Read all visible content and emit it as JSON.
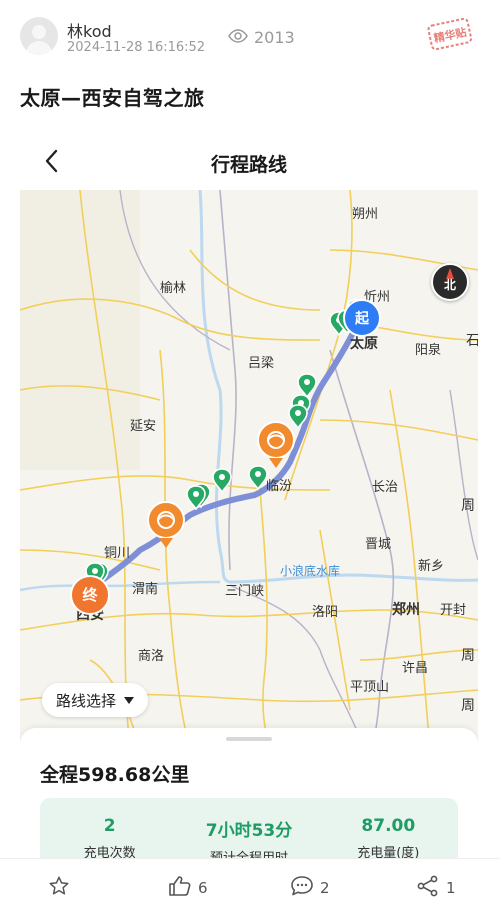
{
  "post": {
    "author": "林kod",
    "time": "2024-11-28 16:16:52",
    "views": "2013",
    "badge": "精华贴",
    "title": "太原—西安自驾之旅"
  },
  "route_screen": {
    "title": "行程路线",
    "route_select_label": "路线选择",
    "compass_label": "北",
    "start_marker": "起",
    "end_marker": "终",
    "map_labels": {
      "shuozhou": "朔州",
      "yulin": "榆林",
      "xinzhou": "忻州",
      "taiyuan": "太原",
      "yangquan": "阳泉",
      "lvliang": "吕梁",
      "yanan": "延安",
      "linfen": "临汾",
      "changzhi": "长治",
      "tongchuan": "铜川",
      "jincheng": "晋城",
      "xiaolangdi": "小浪底水库",
      "xinxiang": "新乡",
      "weinan": "渭南",
      "sanmenxia": "三门峡",
      "luoyang": "洛阳",
      "zhengzhou": "郑州",
      "kaifeng": "开封",
      "xian": "西安",
      "shangluo": "商洛",
      "xuchang": "许昌",
      "pingdingshan": "平顶山",
      "edge_shi": "石",
      "edge_zhou": "周",
      "edge_zhou2": "周",
      "edge_zhou3": "周"
    },
    "total_distance": "全程598.68公里",
    "stats": [
      {
        "value": "2",
        "label": "充电次数"
      },
      {
        "value": "7小时53分",
        "label": "预计全程用时"
      },
      {
        "value": "87.00",
        "label": "充电量(度)"
      }
    ]
  },
  "toolbar": {
    "likes": "6",
    "comments": "2",
    "shares": "1"
  },
  "colors": {
    "accent_green": "#1f9c63",
    "route": "#7f8fd6",
    "start_marker": "#2f7df6",
    "end_marker": "#f0752e",
    "charging_marker": "#f28a2e",
    "waypoint_marker": "#27a864"
  }
}
